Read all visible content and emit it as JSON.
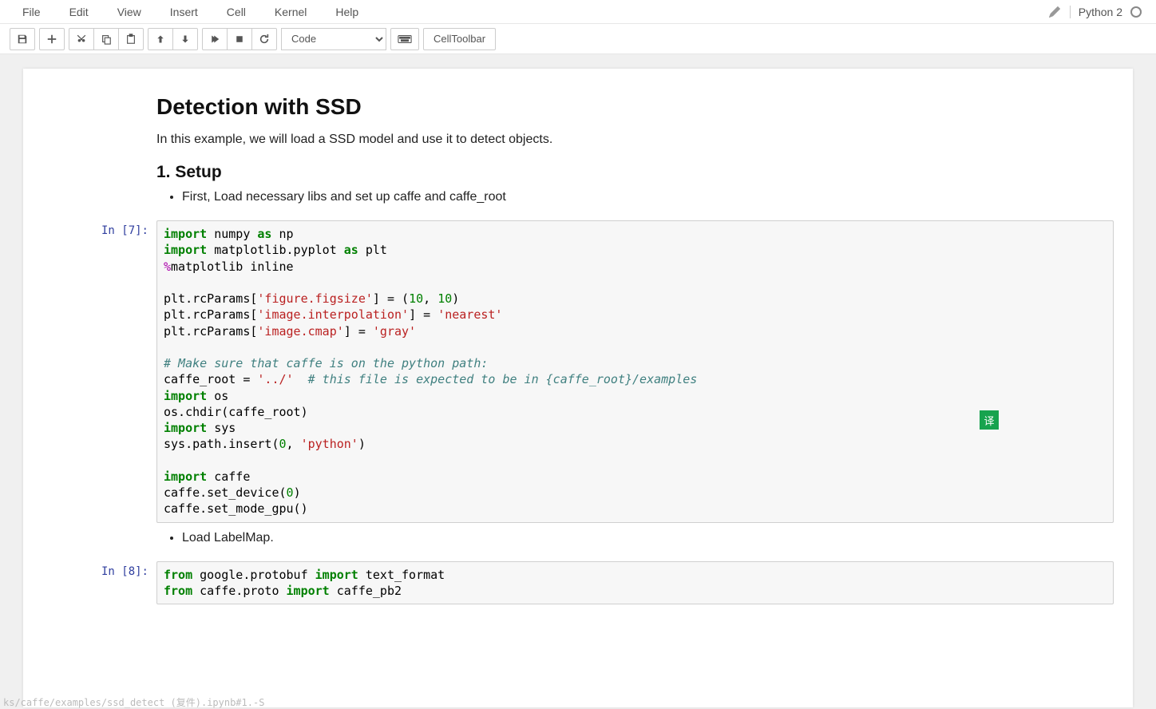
{
  "menubar": {
    "items": [
      "File",
      "Edit",
      "View",
      "Insert",
      "Cell",
      "Kernel",
      "Help"
    ]
  },
  "kernel": {
    "name": "Python 2"
  },
  "toolbar": {
    "cell_type_options": [
      "Code"
    ],
    "cell_type_selected": "Code",
    "cell_toolbar_label": "CellToolbar"
  },
  "cells": {
    "md1": {
      "h1": "Detection with SSD",
      "p1": "In this example, we will load a SSD model and use it to detect objects.",
      "h2": "1. Setup",
      "li1": "First, Load necessary libs and set up caffe and caffe_root"
    },
    "code7": {
      "prompt": "In [7]:",
      "lines": [
        [
          "kw:import",
          " numpy ",
          "kw:as",
          " np"
        ],
        [
          "kw:import",
          " matplotlib.pyplot ",
          "kw:as",
          " plt"
        ],
        [
          "magic:%",
          "matplotlib inline"
        ],
        [
          ""
        ],
        [
          "plt.rcParams[",
          "str:'figure.figsize'",
          "] = (",
          "num:10",
          ", ",
          "num:10",
          ")"
        ],
        [
          "plt.rcParams[",
          "str:'image.interpolation'",
          "] = ",
          "str:'nearest'"
        ],
        [
          "plt.rcParams[",
          "str:'image.cmap'",
          "] = ",
          "str:'gray'"
        ],
        [
          ""
        ],
        [
          "comment:# Make sure that caffe is on the python path:"
        ],
        [
          "caffe_root = ",
          "str:'../'",
          "  ",
          "comment:# this file is expected to be in {caffe_root}/examples"
        ],
        [
          "kw:import",
          " os"
        ],
        [
          "os.chdir(caffe_root)"
        ],
        [
          "kw:import",
          " sys"
        ],
        [
          "sys.path.insert(",
          "num:0",
          ", ",
          "str:'python'",
          ")"
        ],
        [
          ""
        ],
        [
          "kw:import",
          " caffe"
        ],
        [
          "caffe.set_device(",
          "num:0",
          ")"
        ],
        [
          "caffe.set_mode_gpu()"
        ]
      ]
    },
    "md2": {
      "li1": "Load LabelMap."
    },
    "code8": {
      "prompt": "In [8]:",
      "lines": [
        [
          "kw:from",
          " google.protobuf ",
          "kw:import",
          " text_format"
        ],
        [
          "kw:from",
          " caffe.proto ",
          "kw:import",
          " caffe_pb2"
        ]
      ]
    }
  },
  "translate_badge": "译",
  "statusbar_url_fragment": "ks/caffe/examples/ssd_detect (复件).ipynb#1.-S"
}
